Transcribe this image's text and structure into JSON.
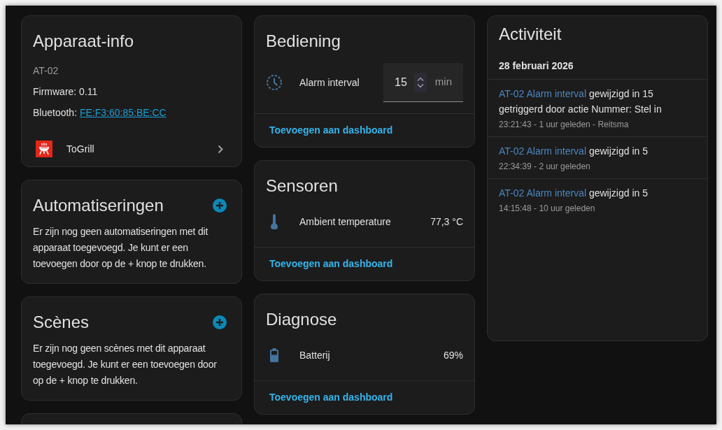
{
  "device_info": {
    "title": "Apparaat-info",
    "model": "AT-02",
    "firmware": "Firmware: 0.11",
    "bluetooth": {
      "label": "Bluetooth:",
      "address": "FE:F3:60:85:BE:CC"
    },
    "integration": {
      "name": "ToGrill"
    }
  },
  "automations": {
    "title": "Automatiseringen",
    "empty_text": "Er zijn nog geen automatiseringen met dit apparaat toegevoegd. Je kunt er een toevoegen door op de + knop te drukken."
  },
  "scenes": {
    "title": "Scènes",
    "empty_text": "Er zijn nog geen scènes met dit apparaat toegevoegd. Je kunt er een toevoegen door op de + knop te drukken."
  },
  "controls": {
    "title": "Bediening",
    "entities": [
      {
        "kind": "number",
        "name": "Alarm interval",
        "value": "15",
        "unit": "min"
      }
    ],
    "action": "Toevoegen aan dashboard"
  },
  "sensors": {
    "title": "Sensoren",
    "entities": [
      {
        "kind": "temperature",
        "name": "Ambient temperature",
        "value": "77,3 °C"
      }
    ],
    "action": "Toevoegen aan dashboard"
  },
  "diagnostics": {
    "title": "Diagnose",
    "entities": [
      {
        "kind": "battery",
        "name": "Batterij",
        "value": "69%"
      }
    ],
    "action": "Toevoegen aan dashboard"
  },
  "activity": {
    "title": "Activiteit",
    "date": "28 februari 2026",
    "entries": [
      {
        "entity": "AT-02 Alarm interval",
        "message": "gewijzigd in 15",
        "context": "getriggerd door actie Nummer: Stel in",
        "meta": "23:21:43 - 1 uur geleden - Reitsma"
      },
      {
        "entity": "AT-02 Alarm interval",
        "message": "gewijzigd in 5",
        "meta": "22:34:39 - 2 uur geleden"
      },
      {
        "entity": "AT-02 Alarm interval",
        "message": "gewijzigd in 5",
        "meta": "14:15:48 - 10 uur geleden"
      }
    ]
  }
}
